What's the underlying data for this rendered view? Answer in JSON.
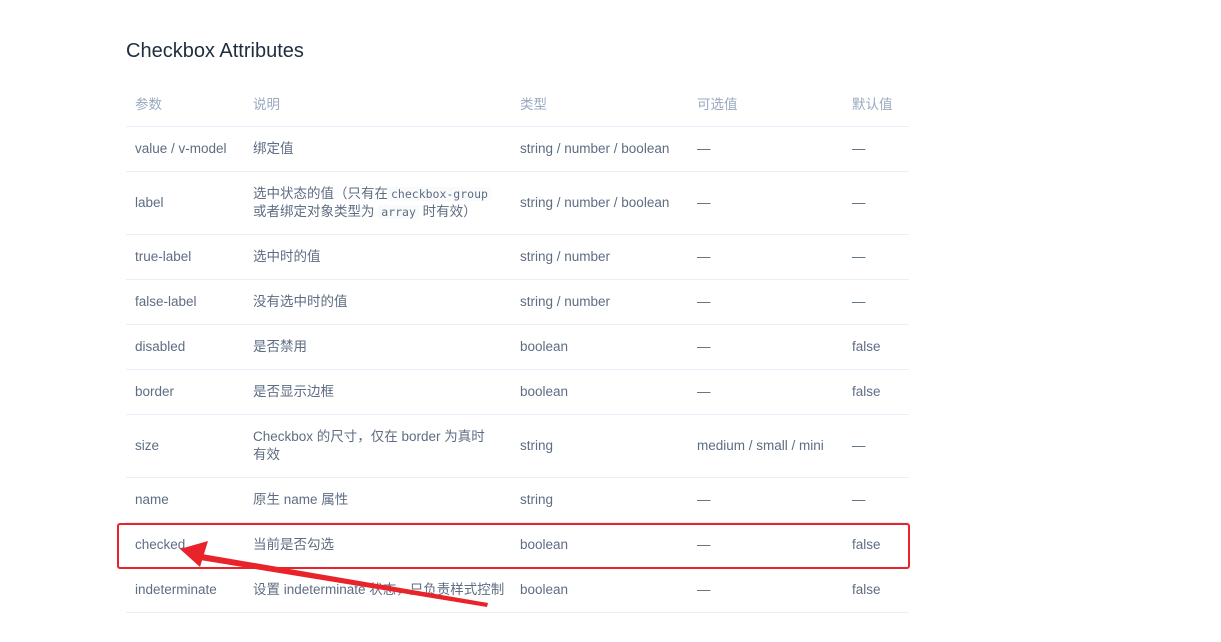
{
  "section_title": "Checkbox Attributes",
  "table": {
    "headers": [
      "参数",
      "说明",
      "类型",
      "可选值",
      "默认值"
    ],
    "rows": [
      {
        "param": "value / v-model",
        "desc": "绑定值",
        "type": "string / number / boolean",
        "options": "—",
        "default": "—"
      },
      {
        "param": "label",
        "desc_pre": "选中状态的值（只有在",
        "desc_code1": "checkbox-group",
        "desc_mid": "或者绑定对象类型为",
        "desc_code2": "array",
        "desc_post": "时有效）",
        "type": "string / number / boolean",
        "options": "—",
        "default": "—"
      },
      {
        "param": "true-label",
        "desc": "选中时的值",
        "type": "string / number",
        "options": "—",
        "default": "—"
      },
      {
        "param": "false-label",
        "desc": "没有选中时的值",
        "type": "string / number",
        "options": "—",
        "default": "—"
      },
      {
        "param": "disabled",
        "desc": "是否禁用",
        "type": "boolean",
        "options": "—",
        "default": "false"
      },
      {
        "param": "border",
        "desc": "是否显示边框",
        "type": "boolean",
        "options": "—",
        "default": "false"
      },
      {
        "param": "size",
        "desc": "Checkbox 的尺寸，仅在 border 为真时有效",
        "type": "string",
        "options": "medium / small / mini",
        "default": "—"
      },
      {
        "param": "name",
        "desc": "原生 name 属性",
        "type": "string",
        "options": "—",
        "default": "—"
      },
      {
        "param": "checked",
        "desc": "当前是否勾选",
        "type": "boolean",
        "options": "—",
        "default": "false"
      },
      {
        "param": "indeterminate",
        "desc": "设置 indeterminate 状态，只负责样式控制",
        "type": "boolean",
        "options": "—",
        "default": "false"
      }
    ]
  },
  "annotation": {
    "highlight_color": "#e8242a",
    "arrow_color": "#e8242a"
  }
}
